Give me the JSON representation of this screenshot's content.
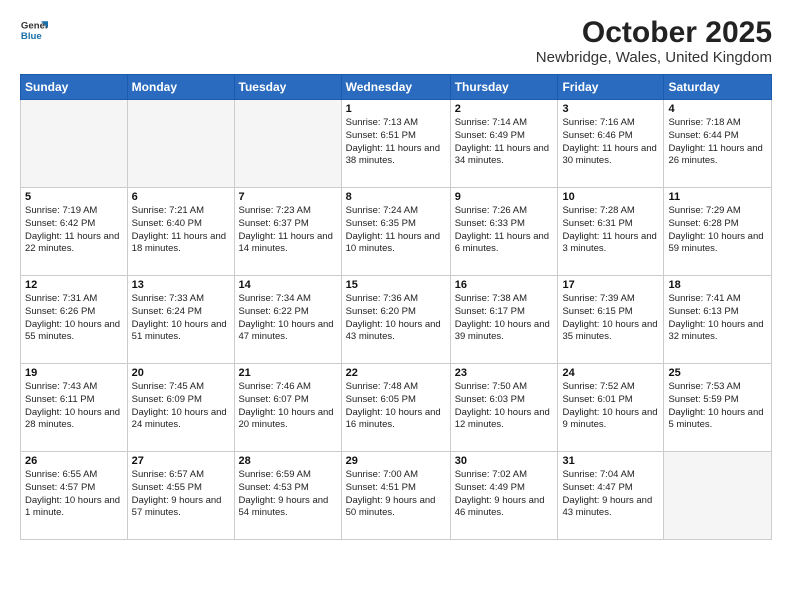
{
  "header": {
    "logo_line1": "General",
    "logo_line2": "Blue",
    "title": "October 2025",
    "subtitle": "Newbridge, Wales, United Kingdom"
  },
  "days_of_week": [
    "Sunday",
    "Monday",
    "Tuesday",
    "Wednesday",
    "Thursday",
    "Friday",
    "Saturday"
  ],
  "weeks": [
    [
      {
        "day": "",
        "empty": true
      },
      {
        "day": "",
        "empty": true
      },
      {
        "day": "",
        "empty": true
      },
      {
        "day": "1",
        "sunrise": "7:13 AM",
        "sunset": "6:51 PM",
        "daylight": "11 hours and 38 minutes."
      },
      {
        "day": "2",
        "sunrise": "7:14 AM",
        "sunset": "6:49 PM",
        "daylight": "11 hours and 34 minutes."
      },
      {
        "day": "3",
        "sunrise": "7:16 AM",
        "sunset": "6:46 PM",
        "daylight": "11 hours and 30 minutes."
      },
      {
        "day": "4",
        "sunrise": "7:18 AM",
        "sunset": "6:44 PM",
        "daylight": "11 hours and 26 minutes."
      }
    ],
    [
      {
        "day": "5",
        "sunrise": "7:19 AM",
        "sunset": "6:42 PM",
        "daylight": "11 hours and 22 minutes."
      },
      {
        "day": "6",
        "sunrise": "7:21 AM",
        "sunset": "6:40 PM",
        "daylight": "11 hours and 18 minutes."
      },
      {
        "day": "7",
        "sunrise": "7:23 AM",
        "sunset": "6:37 PM",
        "daylight": "11 hours and 14 minutes."
      },
      {
        "day": "8",
        "sunrise": "7:24 AM",
        "sunset": "6:35 PM",
        "daylight": "11 hours and 10 minutes."
      },
      {
        "day": "9",
        "sunrise": "7:26 AM",
        "sunset": "6:33 PM",
        "daylight": "11 hours and 6 minutes."
      },
      {
        "day": "10",
        "sunrise": "7:28 AM",
        "sunset": "6:31 PM",
        "daylight": "11 hours and 3 minutes."
      },
      {
        "day": "11",
        "sunrise": "7:29 AM",
        "sunset": "6:28 PM",
        "daylight": "10 hours and 59 minutes."
      }
    ],
    [
      {
        "day": "12",
        "sunrise": "7:31 AM",
        "sunset": "6:26 PM",
        "daylight": "10 hours and 55 minutes."
      },
      {
        "day": "13",
        "sunrise": "7:33 AM",
        "sunset": "6:24 PM",
        "daylight": "10 hours and 51 minutes."
      },
      {
        "day": "14",
        "sunrise": "7:34 AM",
        "sunset": "6:22 PM",
        "daylight": "10 hours and 47 minutes."
      },
      {
        "day": "15",
        "sunrise": "7:36 AM",
        "sunset": "6:20 PM",
        "daylight": "10 hours and 43 minutes."
      },
      {
        "day": "16",
        "sunrise": "7:38 AM",
        "sunset": "6:17 PM",
        "daylight": "10 hours and 39 minutes."
      },
      {
        "day": "17",
        "sunrise": "7:39 AM",
        "sunset": "6:15 PM",
        "daylight": "10 hours and 35 minutes."
      },
      {
        "day": "18",
        "sunrise": "7:41 AM",
        "sunset": "6:13 PM",
        "daylight": "10 hours and 32 minutes."
      }
    ],
    [
      {
        "day": "19",
        "sunrise": "7:43 AM",
        "sunset": "6:11 PM",
        "daylight": "10 hours and 28 minutes."
      },
      {
        "day": "20",
        "sunrise": "7:45 AM",
        "sunset": "6:09 PM",
        "daylight": "10 hours and 24 minutes."
      },
      {
        "day": "21",
        "sunrise": "7:46 AM",
        "sunset": "6:07 PM",
        "daylight": "10 hours and 20 minutes."
      },
      {
        "day": "22",
        "sunrise": "7:48 AM",
        "sunset": "6:05 PM",
        "daylight": "10 hours and 16 minutes."
      },
      {
        "day": "23",
        "sunrise": "7:50 AM",
        "sunset": "6:03 PM",
        "daylight": "10 hours and 12 minutes."
      },
      {
        "day": "24",
        "sunrise": "7:52 AM",
        "sunset": "6:01 PM",
        "daylight": "10 hours and 9 minutes."
      },
      {
        "day": "25",
        "sunrise": "7:53 AM",
        "sunset": "5:59 PM",
        "daylight": "10 hours and 5 minutes."
      }
    ],
    [
      {
        "day": "26",
        "sunrise": "6:55 AM",
        "sunset": "4:57 PM",
        "daylight": "10 hours and 1 minute."
      },
      {
        "day": "27",
        "sunrise": "6:57 AM",
        "sunset": "4:55 PM",
        "daylight": "9 hours and 57 minutes."
      },
      {
        "day": "28",
        "sunrise": "6:59 AM",
        "sunset": "4:53 PM",
        "daylight": "9 hours and 54 minutes."
      },
      {
        "day": "29",
        "sunrise": "7:00 AM",
        "sunset": "4:51 PM",
        "daylight": "9 hours and 50 minutes."
      },
      {
        "day": "30",
        "sunrise": "7:02 AM",
        "sunset": "4:49 PM",
        "daylight": "9 hours and 46 minutes."
      },
      {
        "day": "31",
        "sunrise": "7:04 AM",
        "sunset": "4:47 PM",
        "daylight": "9 hours and 43 minutes."
      },
      {
        "day": "",
        "empty": true
      }
    ]
  ]
}
